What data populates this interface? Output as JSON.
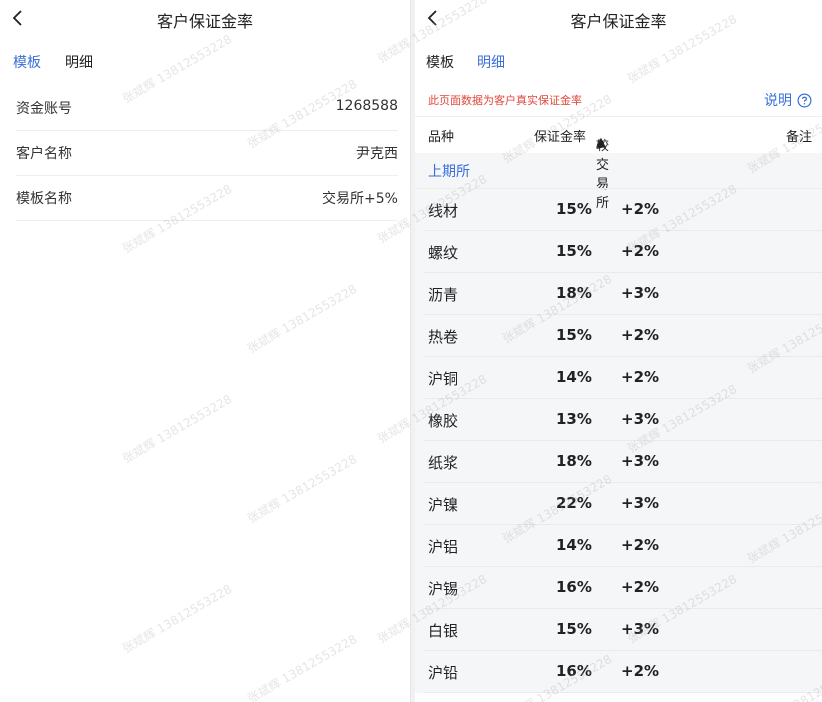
{
  "left": {
    "title": "客户保证金率",
    "tabs": [
      {
        "label": "模板",
        "active": true
      },
      {
        "label": "明细",
        "active": false
      }
    ],
    "info": [
      {
        "label": "资金账号",
        "value": "1268588"
      },
      {
        "label": "客户名称",
        "value": "尹克西"
      },
      {
        "label": "模板名称",
        "value": "交易所+5%"
      }
    ]
  },
  "right": {
    "title": "客户保证金率",
    "tabs": [
      {
        "label": "模板",
        "active": false
      },
      {
        "label": "明细",
        "active": true
      }
    ],
    "notice": "此页面数据为客户真实保证金率",
    "explain_label": "说明",
    "columns": {
      "name": "品种",
      "rate": "保证金率",
      "diff": "较交易所",
      "note": "备注"
    },
    "group": "上期所",
    "rows": [
      {
        "name": "线材",
        "rate": "15%",
        "diff": "+2%"
      },
      {
        "name": "螺纹",
        "rate": "15%",
        "diff": "+2%"
      },
      {
        "name": "沥青",
        "rate": "18%",
        "diff": "+3%"
      },
      {
        "name": "热卷",
        "rate": "15%",
        "diff": "+2%"
      },
      {
        "name": "沪铜",
        "rate": "14%",
        "diff": "+2%"
      },
      {
        "name": "橡胶",
        "rate": "13%",
        "diff": "+3%"
      },
      {
        "name": "纸浆",
        "rate": "18%",
        "diff": "+3%"
      },
      {
        "name": "沪镍",
        "rate": "22%",
        "diff": "+3%"
      },
      {
        "name": "沪铝",
        "rate": "14%",
        "diff": "+2%"
      },
      {
        "name": "沪锡",
        "rate": "16%",
        "diff": "+2%"
      },
      {
        "name": "白银",
        "rate": "15%",
        "diff": "+3%"
      },
      {
        "name": "沪铅",
        "rate": "16%",
        "diff": "+2%"
      }
    ]
  },
  "watermark": "张斌辉 13812553228",
  "colors": {
    "accent": "#3a6fd8",
    "notice": "#e0473b",
    "group_bg": "#f5f6f8"
  }
}
